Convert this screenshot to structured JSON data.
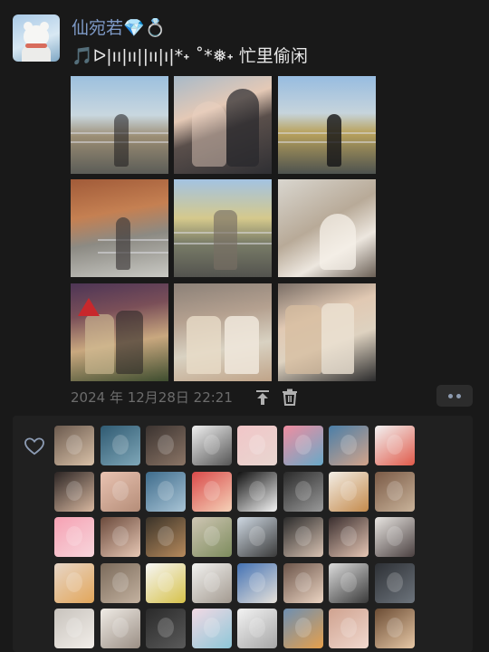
{
  "post": {
    "nickname": "仙宛若",
    "nickname_gem": "💎",
    "nickname_ring": "💍",
    "status_text": "🎵ᐅ|ıı|ıı||ıı|ı|*˖ ˚*❅˖ 忙里偷闲",
    "timestamp": "2024 年 12月28日 22:21"
  },
  "colors": {
    "nickname": "#7e9ac7",
    "background": "#191919",
    "likes_panel": "#202020",
    "meta_text": "#6c6c6c"
  },
  "icons": {
    "avatar": "white-bear-avatar",
    "pin": "pin-to-top-icon",
    "delete": "trash-icon",
    "more": "more-dots-icon",
    "like": "heart-outline-icon"
  },
  "photos": [
    {
      "subject": "woman-by-river-railing"
    },
    {
      "subject": "couple-selfie"
    },
    {
      "subject": "man-by-river-railing"
    },
    {
      "subject": "woman-autumn-path"
    },
    {
      "subject": "woman-railing-sunset"
    },
    {
      "subject": "woman-sitting-lattice"
    },
    {
      "subject": "couple-christmas-selfie"
    },
    {
      "subject": "two-friends-sitting"
    },
    {
      "subject": "two-friends-mirror-selfie"
    }
  ],
  "likers": [
    {
      "avatar": "girl-reading"
    },
    {
      "avatar": "swimmers-water"
    },
    {
      "avatar": "man-portrait-dark"
    },
    {
      "avatar": "manga-face"
    },
    {
      "avatar": "pink-sky"
    },
    {
      "avatar": "pink-fish-illustration"
    },
    {
      "avatar": "woman-blue-sky"
    },
    {
      "avatar": "crayon-shinchan"
    },
    {
      "avatar": "woman-black-hair"
    },
    {
      "avatar": "girl-selfie"
    },
    {
      "avatar": "blue-scene"
    },
    {
      "avatar": "anime-girl-red"
    },
    {
      "avatar": "comic-face"
    },
    {
      "avatar": "man-black-white"
    },
    {
      "avatar": "bear-cartoon"
    },
    {
      "avatar": "man-outdoor"
    },
    {
      "avatar": "pink-drawing"
    },
    {
      "avatar": "girl-bangs"
    },
    {
      "avatar": "dog-dark"
    },
    {
      "avatar": "woman-flowers"
    },
    {
      "avatar": "man-hat"
    },
    {
      "avatar": "girl-hat"
    },
    {
      "avatar": "girl-hand-face"
    },
    {
      "avatar": "anime-girl-portrait"
    },
    {
      "avatar": "cartoon-boy"
    },
    {
      "avatar": "cat-indoor"
    },
    {
      "avatar": "dog-sticker"
    },
    {
      "avatar": "woman-sketch"
    },
    {
      "avatar": "blue-bear"
    },
    {
      "avatar": "girl-sweater"
    },
    {
      "avatar": "dancers-street"
    },
    {
      "avatar": "man-dark-street"
    },
    {
      "avatar": "white-puppy"
    },
    {
      "avatar": "woman-sketch-2"
    },
    {
      "avatar": "dark-scene"
    },
    {
      "avatar": "colorful-stickers"
    },
    {
      "avatar": "cat-cartoon"
    },
    {
      "avatar": "orange-cartoon"
    },
    {
      "avatar": "girl-pink-hair"
    },
    {
      "avatar": "christmas-tree"
    }
  ]
}
